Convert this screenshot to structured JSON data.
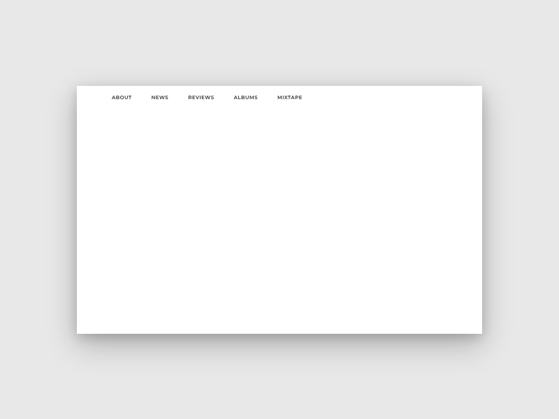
{
  "nav": {
    "items": [
      {
        "label": "ABOUT"
      },
      {
        "label": "NEWS"
      },
      {
        "label": "REVIEWS"
      },
      {
        "label": "ALBUMS"
      },
      {
        "label": "MIXTAPE"
      }
    ]
  }
}
